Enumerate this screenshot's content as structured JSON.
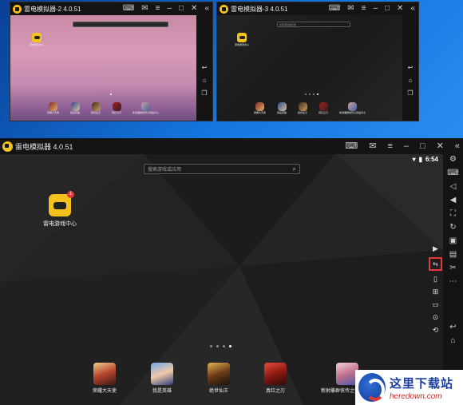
{
  "colors": {
    "accent": "#f4c21c",
    "badge": "#e53935",
    "highlight": "#e53935",
    "window_bg": "#222222"
  },
  "window1": {
    "title": "雷电模拟器-2 4.0.51",
    "app_label": "雷电游戏中心",
    "dock": [
      "荣耀大天使",
      "我是英雄",
      "绝世仙王",
      "真红之刃",
      "新射雕群侠传之铁血丹心"
    ]
  },
  "window2": {
    "title": "雷电模拟器-3 4.0.51",
    "search_placeholder": "搜索游戏或应用",
    "app_label": "雷电游戏中心",
    "dock": [
      "荣耀大天使",
      "我是英雄",
      "绝世仙王",
      "真红之刃",
      "新射雕群侠传之铁血丹心"
    ]
  },
  "window3": {
    "title": "雷电模拟器 4.0.51",
    "search_placeholder": "搜索游戏或应用",
    "status_time": "6:54",
    "app_label": "雷电游戏中心",
    "app_badge": "1",
    "dock": [
      "荣耀大天使",
      "我是英雄",
      "绝世仙王",
      "真红之刃",
      "新射雕群侠传之铁血丹心"
    ],
    "page_dots": 4,
    "active_dot": 3
  },
  "watermark": {
    "name": "这里下载站",
    "url": "heredown.com"
  }
}
